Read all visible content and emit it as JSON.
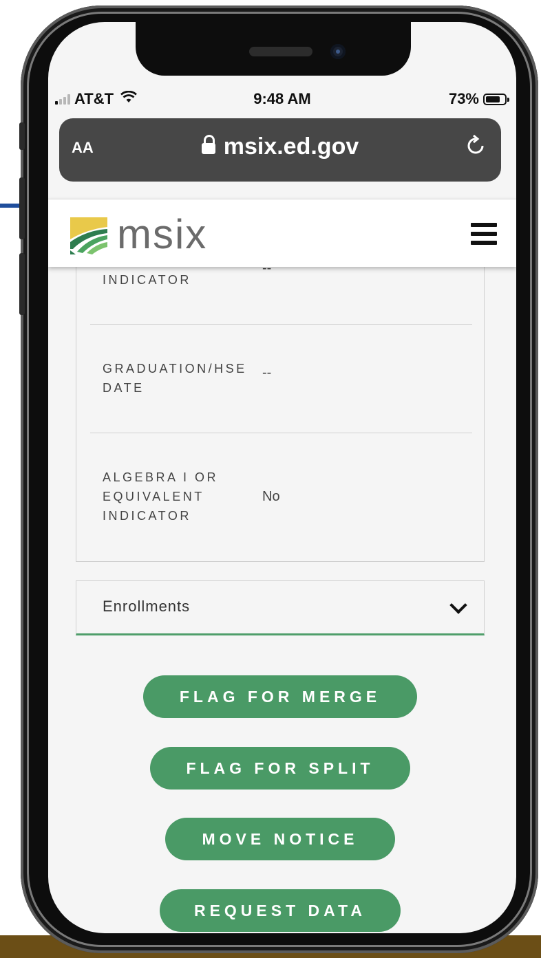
{
  "status_bar": {
    "carrier": "AT&T",
    "time": "9:48 AM",
    "battery_percent": "73%"
  },
  "browser": {
    "text_size_label": "AA",
    "url": "msix.ed.gov",
    "reload_icon": "reload-icon"
  },
  "site_header": {
    "logo_text": "msix",
    "menu_icon": "hamburger-menu-icon"
  },
  "details": [
    {
      "label": "INDICATOR",
      "value": "--"
    },
    {
      "label": "GRADUATION/HSE DATE",
      "value": "--"
    },
    {
      "label": "ALGEBRA I OR EQUIVALENT INDICATOR",
      "value": "No"
    }
  ],
  "enrollments": {
    "label": "Enrollments",
    "icon": "chevron-down-icon"
  },
  "actions": [
    {
      "label": "FLAG FOR MERGE"
    },
    {
      "label": "FLAG FOR SPLIT"
    },
    {
      "label": "MOVE NOTICE"
    },
    {
      "label": "REQUEST DATA"
    }
  ],
  "colors": {
    "accent_green": "#4a9a66",
    "url_bar": "#474747",
    "brand_blue": "#1f4e9c",
    "footer_gold": "#6b4e16"
  }
}
